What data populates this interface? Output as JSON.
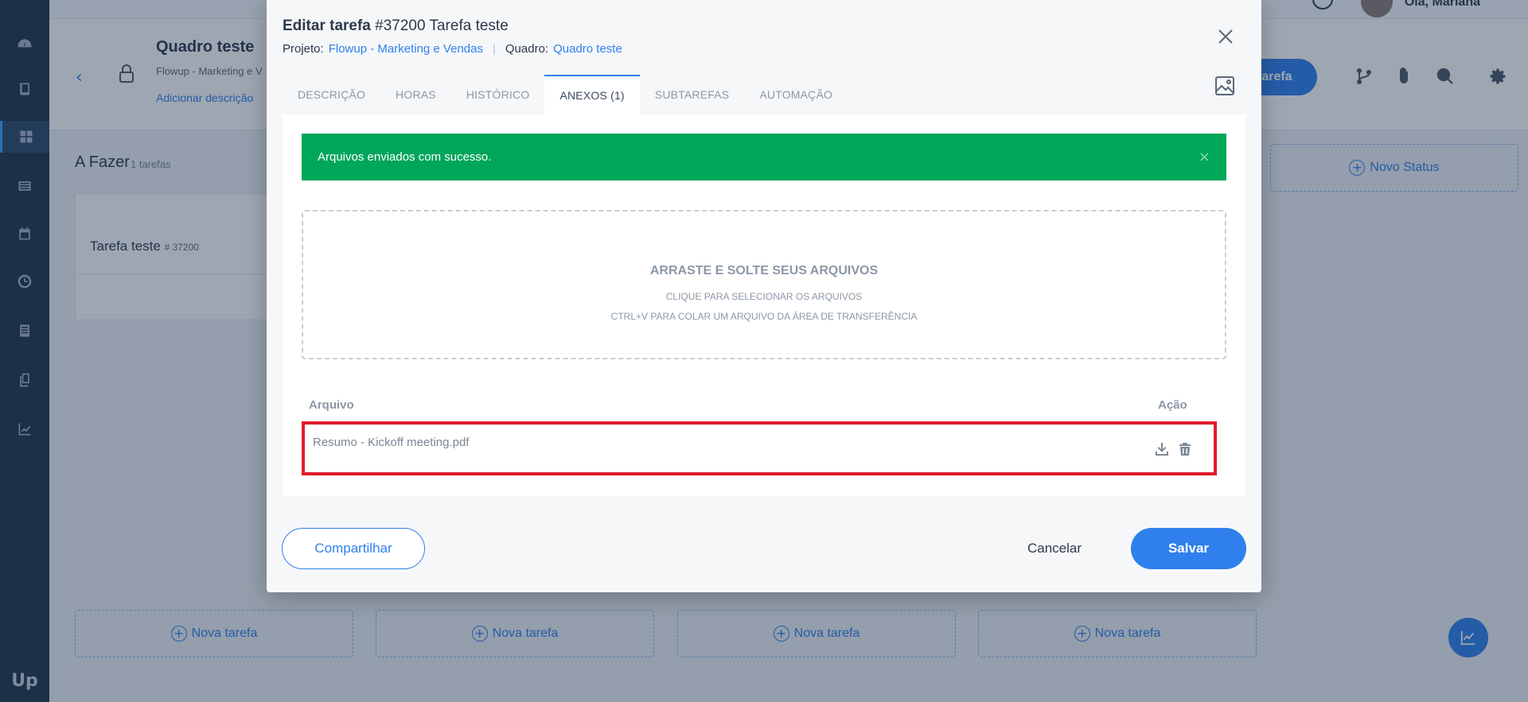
{
  "topbar": {
    "greeting": "Olá, Mariana"
  },
  "board": {
    "title": "Quadro teste",
    "subtitle": "Flowup - Marketing e V",
    "add_description": "Adicionar descrição",
    "new_task_button": "tarefa",
    "column_title": "A Fazer",
    "column_count": "1 tarefas",
    "card_name": "Tarefa teste",
    "card_id": "# 37200",
    "new_status": "Novo Status",
    "new_task_slots": [
      "Nova tarefa",
      "Nova tarefa",
      "Nova tarefa",
      "Nova tarefa"
    ],
    "logo": "Up"
  },
  "modal": {
    "title_prefix": "Editar tarefa",
    "title_rest": "#37200 Tarefa teste",
    "project_label": "Projeto:",
    "project_value": "Flowup - Marketing e Vendas",
    "board_label": "Quadro:",
    "board_value": "Quadro teste",
    "tabs": [
      {
        "label": "DESCRIÇÃO",
        "active": false
      },
      {
        "label": "HORAS",
        "active": false
      },
      {
        "label": "HISTÓRICO",
        "active": false
      },
      {
        "label": "ANEXOS (1)",
        "active": true
      },
      {
        "label": "SUBTAREFAS",
        "active": false
      },
      {
        "label": "AUTOMAÇÃO",
        "active": false
      }
    ],
    "alert": "Arquivos enviados com sucesso.",
    "dropzone": {
      "title": "ARRASTE E SOLTE SEUS ARQUIVOS",
      "line1": "CLIQUE PARA SELECIONAR OS ARQUIVOS",
      "line2": "CTRL+V PARA COLAR UM ARQUIVO DA ÁREA DE TRANSFERÊNCIA"
    },
    "table": {
      "col_file": "Arquivo",
      "col_action": "Ação",
      "rows": [
        {
          "file": "Resumo - Kickoff meeting.pdf"
        }
      ]
    },
    "buttons": {
      "share": "Compartilhar",
      "cancel": "Cancelar",
      "save": "Salvar"
    }
  },
  "colors": {
    "accent": "#2f80ed",
    "success": "#00a65a",
    "highlight": "#e21a2c",
    "sidebar": "#1f3548"
  },
  "icons": [
    "dashboard-icon",
    "book-icon",
    "grid-icon",
    "list-icon",
    "calendar-icon",
    "clock-icon",
    "notes-icon",
    "copy-icon",
    "chart-icon",
    "close-icon",
    "image-icon",
    "download-icon",
    "trash-icon",
    "lock-icon",
    "branch-icon",
    "paperclip-icon",
    "search-icon",
    "gear-icon"
  ]
}
